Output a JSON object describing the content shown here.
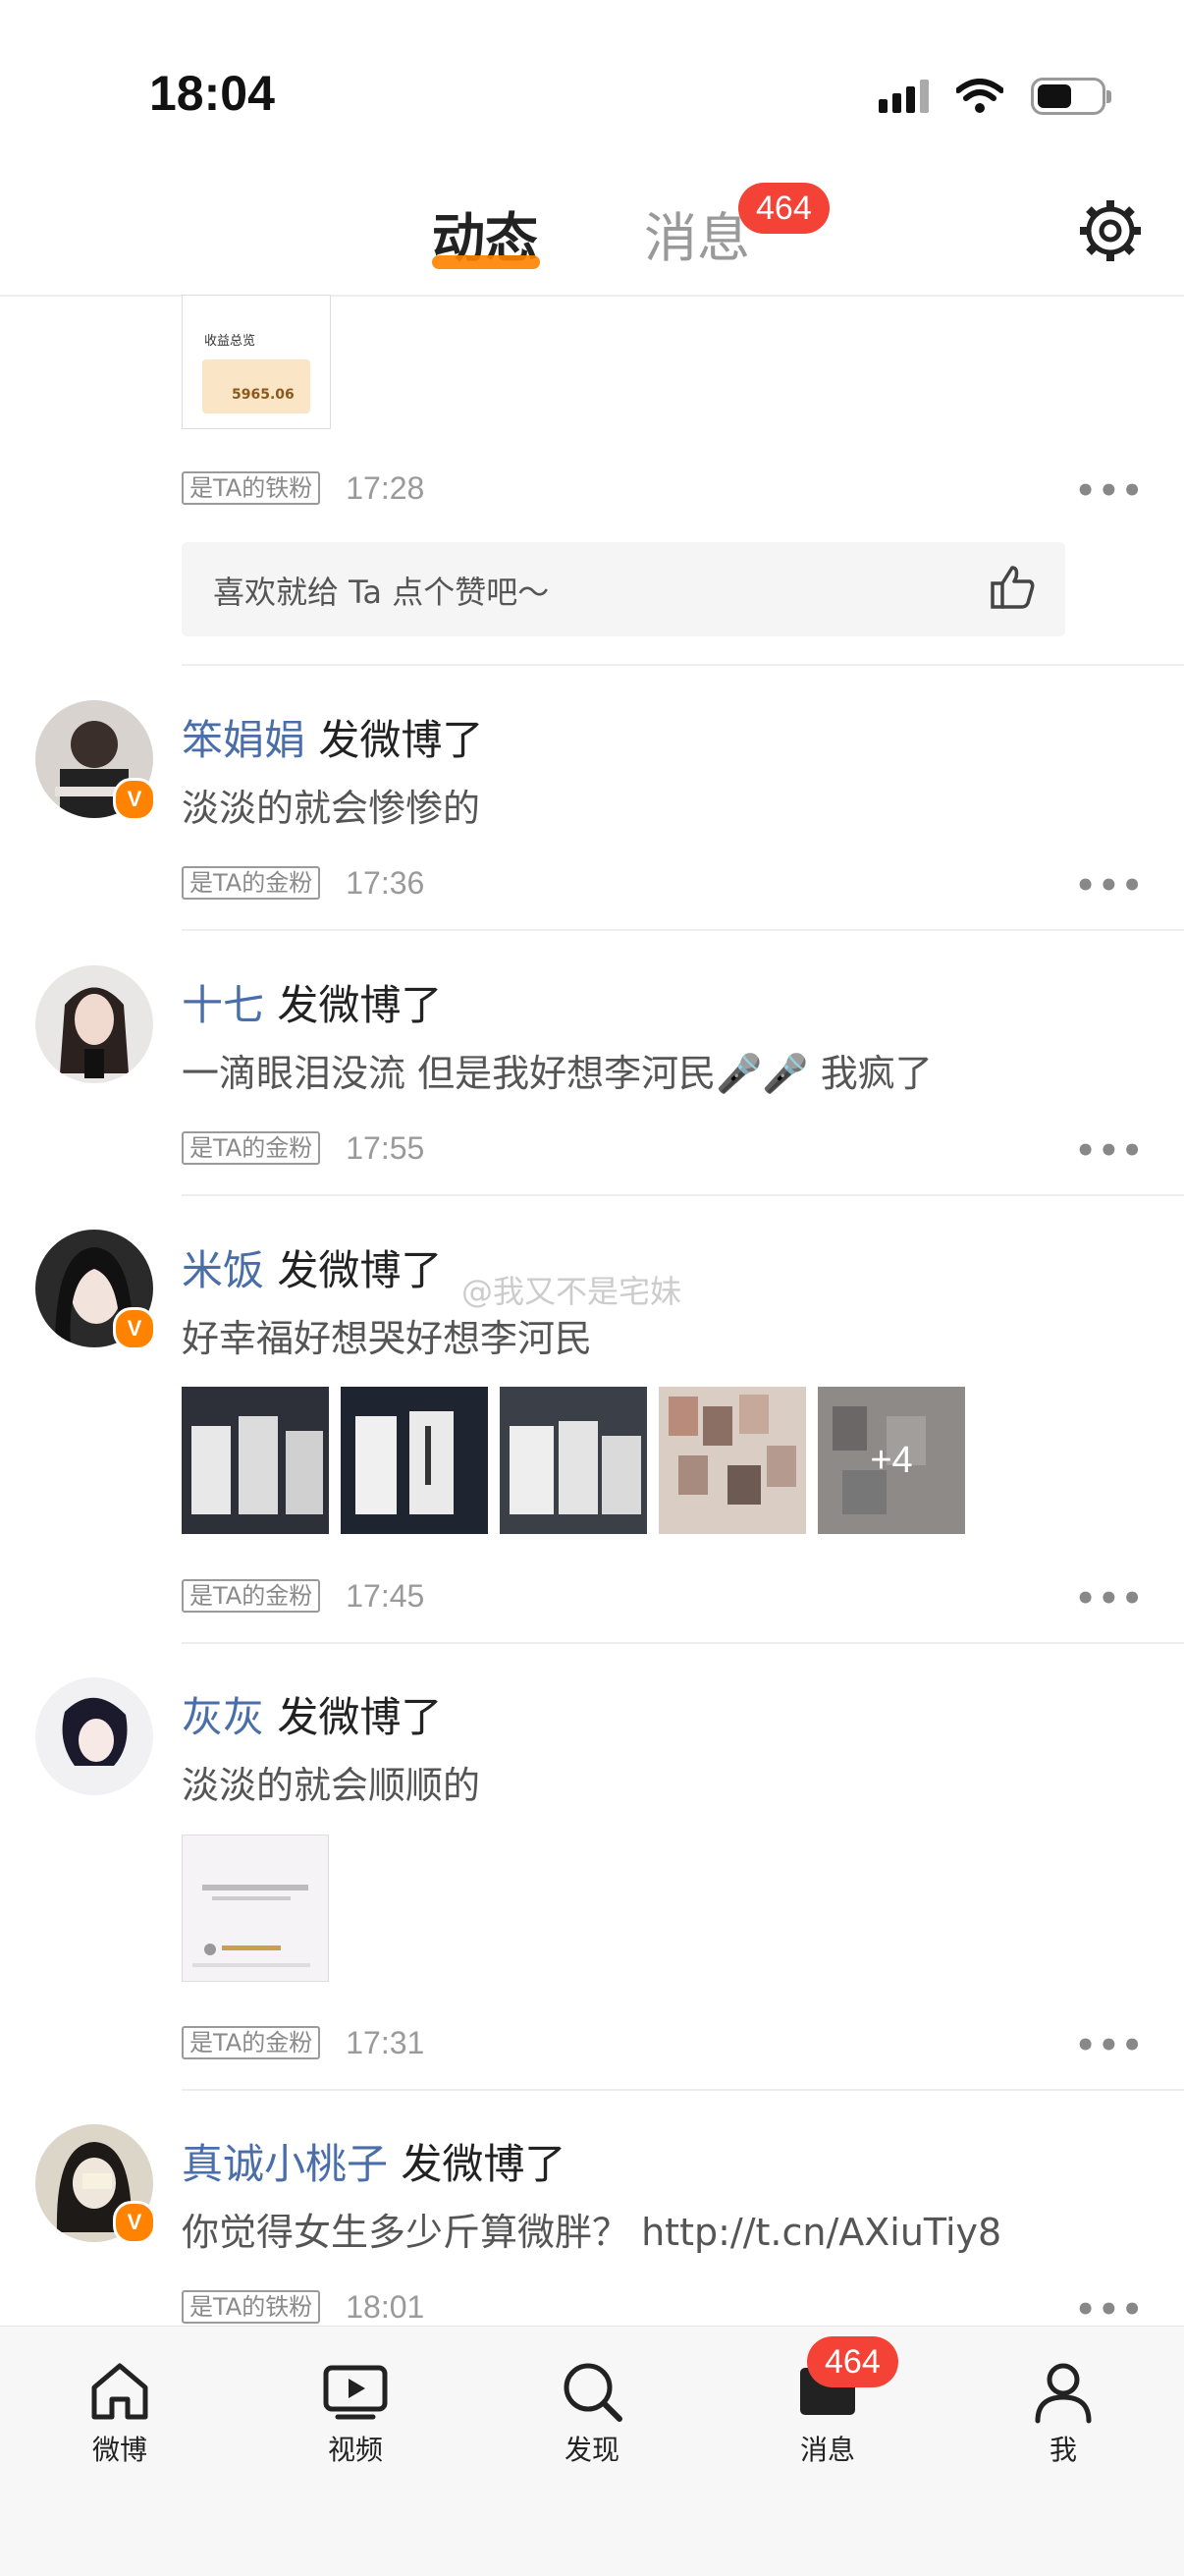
{
  "status": {
    "time": "18:04"
  },
  "header": {
    "tabs": [
      {
        "label": "动态"
      },
      {
        "label": "消息"
      }
    ],
    "message_badge": "464"
  },
  "top_card": {
    "thumb_title": "收益总览",
    "thumb_amount": "5965.06",
    "fan_tag": "是TA的铁粉",
    "time": "17:28",
    "like_prompt": "喜欢就给 Ta 点个赞吧～"
  },
  "posts": [
    {
      "name": "笨娟娟",
      "action": "发微博了",
      "text": "淡淡的就会惨惨的",
      "fan_tag": "是TA的金粉",
      "time": "17:36",
      "verified": "V"
    },
    {
      "name": "十七",
      "action": "发微博了",
      "text": "一滴眼泪没流 但是我好想李河民🎤🎤 我疯了",
      "fan_tag": "是TA的金粉",
      "time": "17:55"
    },
    {
      "name": "米饭",
      "action": "发微博了",
      "text": "好幸福好想哭好想李河民",
      "fan_tag": "是TA的金粉",
      "time": "17:45",
      "verified": "V",
      "more_images": "+4"
    },
    {
      "name": "灰灰",
      "action": "发微博了",
      "text": "淡淡的就会顺顺的",
      "fan_tag": "是TA的金粉",
      "time": "17:31"
    },
    {
      "name": "真诚小桃子",
      "action": "发微博了",
      "text": "你觉得女生多少斤算微胖？ http://t.cn/AXiuTiy8",
      "fan_tag": "是TA的铁粉",
      "time": "18:01",
      "verified": "V"
    }
  ],
  "watermark": "@我又不是宅妹",
  "tabbar": {
    "items": [
      {
        "label": "微博",
        "icon": "home-icon"
      },
      {
        "label": "视频",
        "icon": "video-icon"
      },
      {
        "label": "发现",
        "icon": "search-icon"
      },
      {
        "label": "消息",
        "icon": "message-icon"
      },
      {
        "label": "我",
        "icon": "profile-icon"
      }
    ],
    "message_badge": "464"
  },
  "colors": {
    "accent": "#ff8200",
    "name_blue": "#4a6ea9",
    "badge_red": "#f44336"
  }
}
